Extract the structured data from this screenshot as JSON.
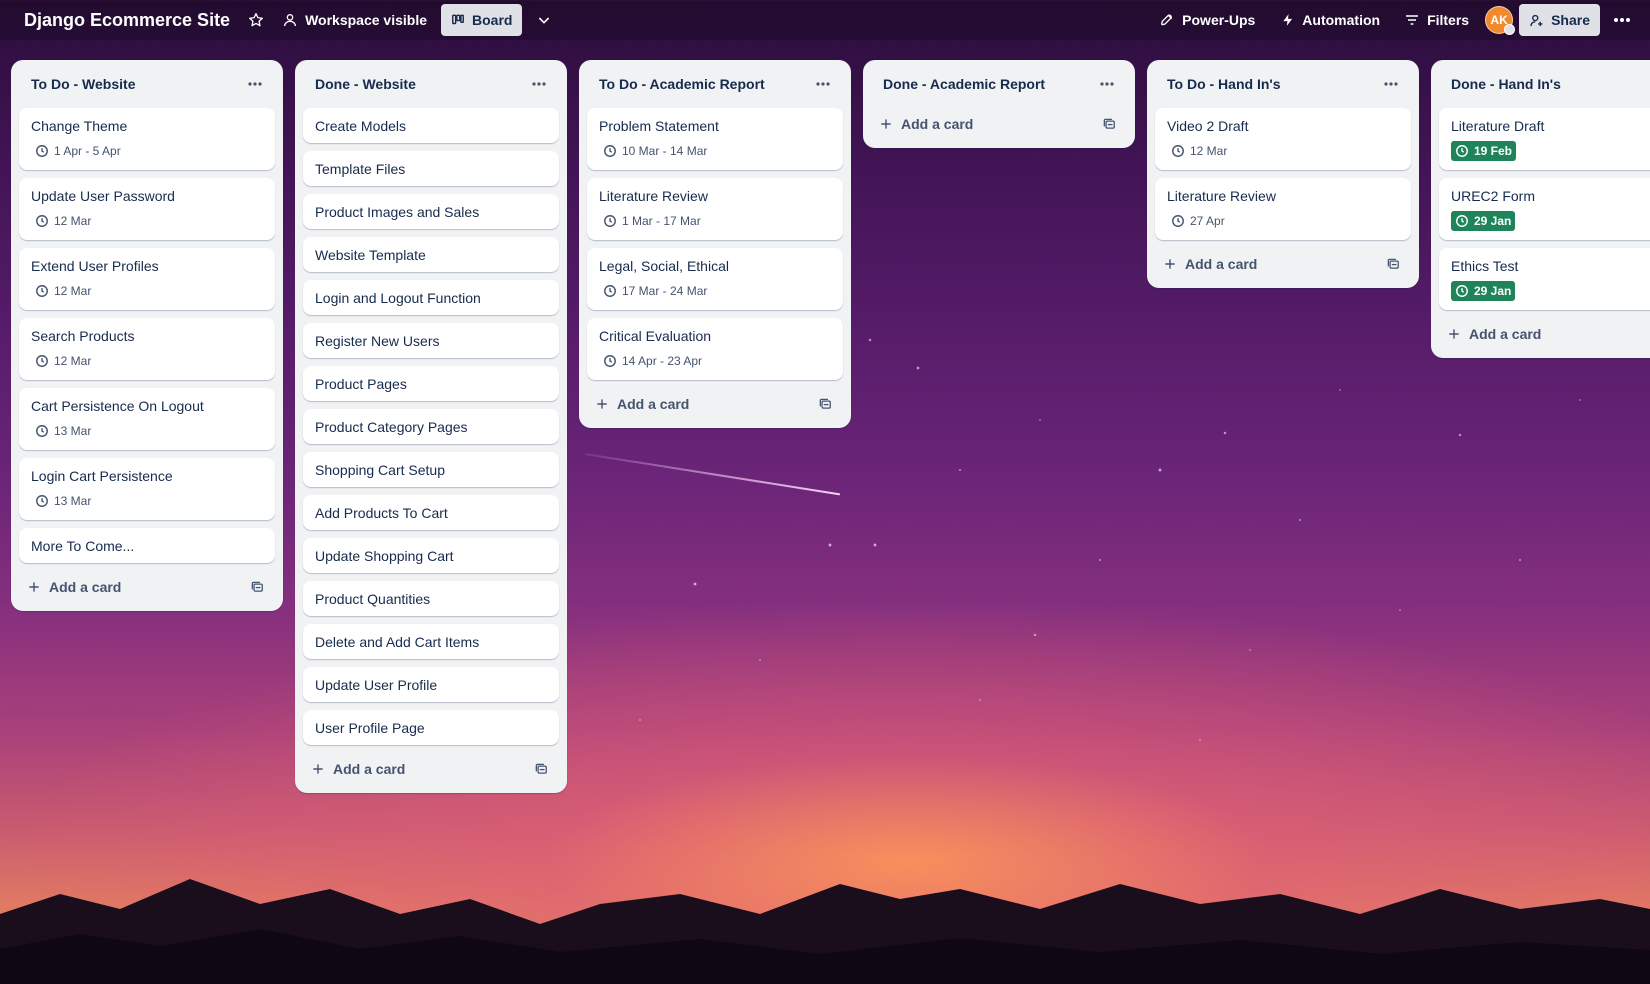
{
  "topbar": {
    "board_title": "Django Ecommerce Site",
    "visibility_label": "Workspace visible",
    "view_label": "Board",
    "powerups_label": "Power-Ups",
    "automation_label": "Automation",
    "filters_label": "Filters",
    "avatar_initials": "AK",
    "share_label": "Share"
  },
  "lists": [
    {
      "title": "To Do - Website",
      "cards": [
        {
          "title": "Change Theme",
          "date": "1 Apr - 5 Apr",
          "done": false
        },
        {
          "title": "Update User Password",
          "date": "12 Mar",
          "done": false
        },
        {
          "title": "Extend User Profiles",
          "date": "12 Mar",
          "done": false
        },
        {
          "title": "Search Products",
          "date": "12 Mar",
          "done": false
        },
        {
          "title": "Cart Persistence On Logout",
          "date": "13 Mar",
          "done": false
        },
        {
          "title": "Login Cart Persistence",
          "date": "13 Mar",
          "done": false
        },
        {
          "title": "More To Come...",
          "date": "",
          "done": false
        }
      ],
      "add_label": "Add a card"
    },
    {
      "title": "Done - Website",
      "cards": [
        {
          "title": "Create Models",
          "date": "",
          "done": false
        },
        {
          "title": "Template Files",
          "date": "",
          "done": false
        },
        {
          "title": "Product Images and Sales",
          "date": "",
          "done": false
        },
        {
          "title": "Website Template",
          "date": "",
          "done": false
        },
        {
          "title": "Login and Logout Function",
          "date": "",
          "done": false
        },
        {
          "title": "Register New Users",
          "date": "",
          "done": false
        },
        {
          "title": "Product Pages",
          "date": "",
          "done": false
        },
        {
          "title": "Product Category Pages",
          "date": "",
          "done": false
        },
        {
          "title": "Shopping Cart Setup",
          "date": "",
          "done": false
        },
        {
          "title": "Add Products To Cart",
          "date": "",
          "done": false
        },
        {
          "title": "Update Shopping Cart",
          "date": "",
          "done": false
        },
        {
          "title": "Product Quantities",
          "date": "",
          "done": false
        },
        {
          "title": "Delete and Add Cart Items",
          "date": "",
          "done": false
        },
        {
          "title": "Update User Profile",
          "date": "",
          "done": false
        },
        {
          "title": "User Profile Page",
          "date": "",
          "done": false
        }
      ],
      "add_label": "Add a card"
    },
    {
      "title": "To Do - Academic Report",
      "cards": [
        {
          "title": "Problem Statement",
          "date": "10 Mar - 14 Mar",
          "done": false
        },
        {
          "title": "Literature Review",
          "date": "1 Mar - 17 Mar",
          "done": false
        },
        {
          "title": "Legal, Social, Ethical",
          "date": "17 Mar - 24 Mar",
          "done": false
        },
        {
          "title": "Critical Evaluation",
          "date": "14 Apr - 23 Apr",
          "done": false
        }
      ],
      "add_label": "Add a card"
    },
    {
      "title": "Done - Academic Report",
      "cards": [],
      "add_label": "Add a card"
    },
    {
      "title": "To Do - Hand In's",
      "cards": [
        {
          "title": "Video 2 Draft",
          "date": "12 Mar",
          "done": false
        },
        {
          "title": "Literature Review",
          "date": "27 Apr",
          "done": false
        }
      ],
      "add_label": "Add a card"
    },
    {
      "title": "Done - Hand In's",
      "cards": [
        {
          "title": "Literature Draft",
          "date": "19 Feb",
          "done": true
        },
        {
          "title": "UREC2 Form",
          "date": "29 Jan",
          "done": true
        },
        {
          "title": "Ethics Test",
          "date": "29 Jan",
          "done": true
        }
      ],
      "add_label": "Add a card"
    }
  ],
  "colors": {
    "done_badge": "#1f845a",
    "list_bg": "#f1f2f4",
    "avatar": "#f18a2e"
  }
}
